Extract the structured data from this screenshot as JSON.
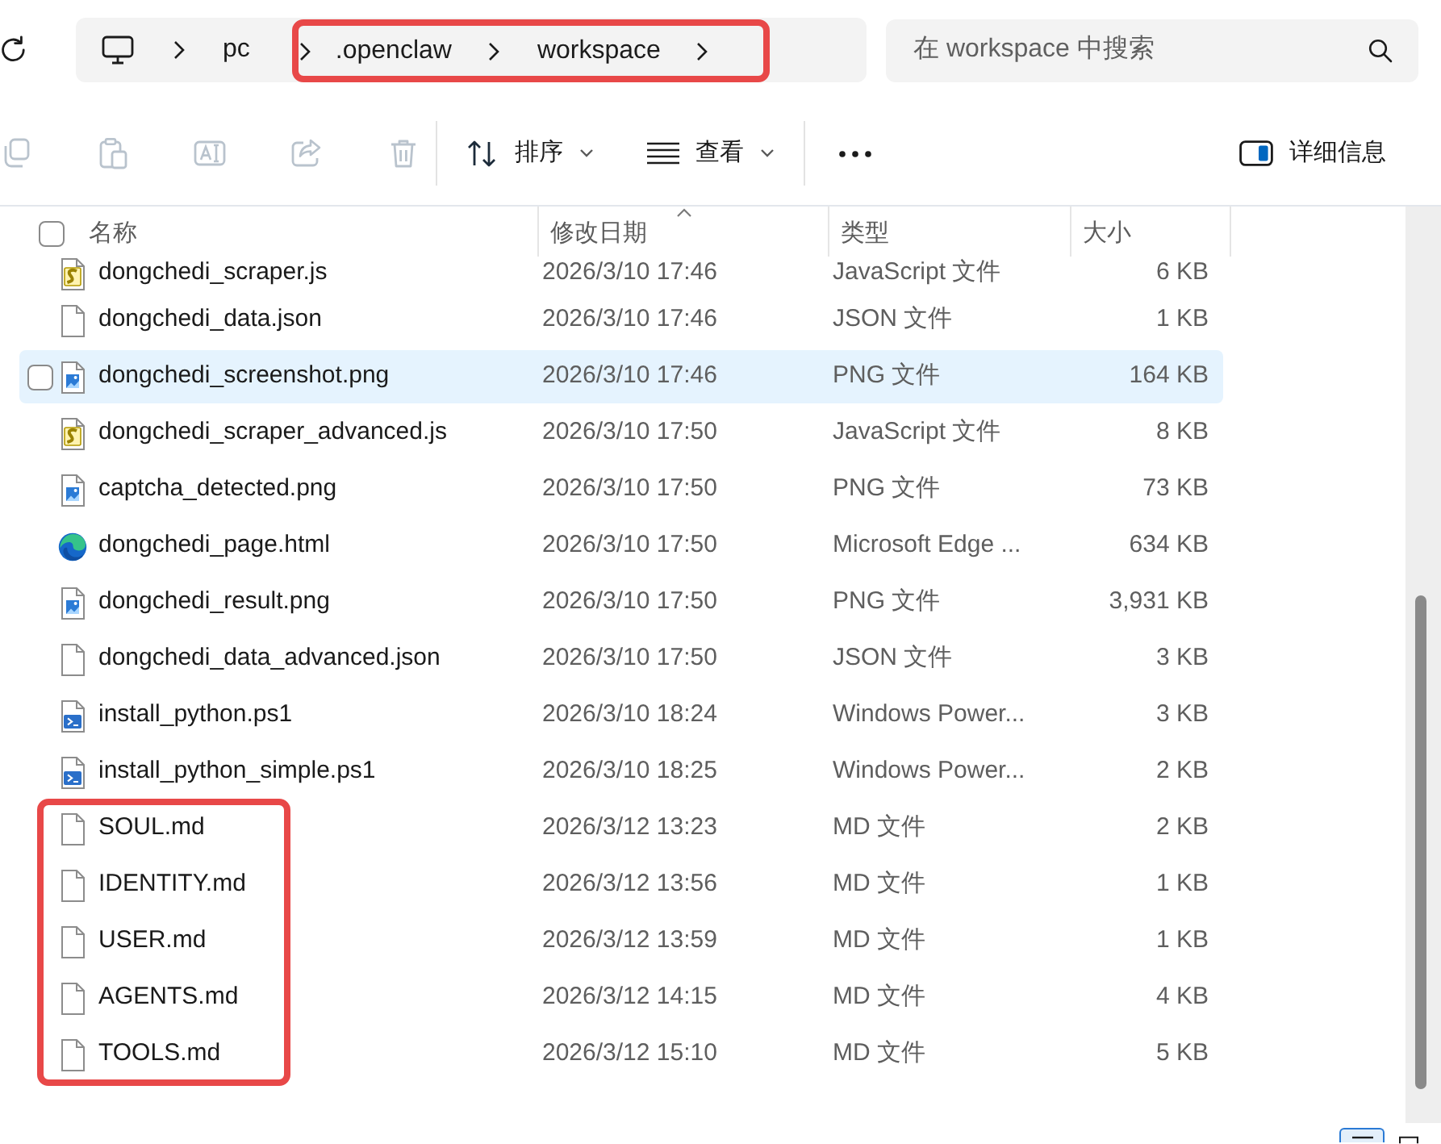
{
  "address_bar": {
    "crumbs": [
      {
        "label": "pc",
        "outlined": false
      },
      {
        "label": ".openclaw",
        "outlined": true
      },
      {
        "label": "workspace",
        "outlined": true
      }
    ]
  },
  "search": {
    "placeholder": "在 workspace 中搜索"
  },
  "toolbar": {
    "actions": [
      {
        "kind": "copy",
        "disabled": true
      },
      {
        "kind": "paste",
        "disabled": true
      },
      {
        "kind": "rename",
        "disabled": true
      },
      {
        "kind": "share",
        "disabled": true
      },
      {
        "kind": "delete",
        "disabled": true
      }
    ],
    "menus": [
      {
        "kind": "sort",
        "label": "排序"
      },
      {
        "kind": "view",
        "label": "查看"
      }
    ],
    "details": {
      "label": "详细信息"
    }
  },
  "file_list": {
    "select_all": {
      "checked": false
    },
    "columns": [
      {
        "label": "名称",
        "sorted": false
      },
      {
        "label": "修改日期",
        "sorted": true
      },
      {
        "label": "类型",
        "sorted": false
      },
      {
        "label": "大小",
        "sorted": false
      }
    ],
    "rows": [
      {
        "name": "dongchedi_scraper.js",
        "modified": "2026/3/10 17:46",
        "type": "JavaScript 文件",
        "size": "6 KB",
        "kind": "script",
        "highlighted": false,
        "selected": false
      },
      {
        "name": "dongchedi_data.json",
        "modified": "2026/3/10 17:46",
        "type": "JSON 文件",
        "size": "1 KB",
        "kind": "document",
        "highlighted": false,
        "selected": false
      },
      {
        "name": "dongchedi_screenshot.png",
        "modified": "2026/3/10 17:46",
        "type": "PNG 文件",
        "size": "164 KB",
        "kind": "image",
        "highlighted": true,
        "selected": false
      },
      {
        "name": "dongchedi_scraper_advanced.js",
        "modified": "2026/3/10 17:50",
        "type": "JavaScript 文件",
        "size": "8 KB",
        "kind": "script",
        "highlighted": false,
        "selected": false
      },
      {
        "name": "captcha_detected.png",
        "modified": "2026/3/10 17:50",
        "type": "PNG 文件",
        "size": "73 KB",
        "kind": "image",
        "highlighted": false,
        "selected": false
      },
      {
        "name": "dongchedi_page.html",
        "modified": "2026/3/10 17:50",
        "type": "Microsoft Edge ...",
        "size": "634 KB",
        "kind": "web",
        "highlighted": false,
        "selected": false
      },
      {
        "name": "dongchedi_result.png",
        "modified": "2026/3/10 17:50",
        "type": "PNG 文件",
        "size": "3,931 KB",
        "kind": "image",
        "highlighted": false,
        "selected": false
      },
      {
        "name": "dongchedi_data_advanced.json",
        "modified": "2026/3/10 17:50",
        "type": "JSON 文件",
        "size": "3 KB",
        "kind": "document",
        "highlighted": false,
        "selected": false
      },
      {
        "name": "install_python.ps1",
        "modified": "2026/3/10 18:24",
        "type": "Windows Power...",
        "size": "3 KB",
        "kind": "powershell",
        "highlighted": false,
        "selected": false
      },
      {
        "name": "install_python_simple.ps1",
        "modified": "2026/3/10 18:25",
        "type": "Windows Power...",
        "size": "2 KB",
        "kind": "powershell",
        "highlighted": false,
        "selected": false
      }
    ],
    "framed_rows": [
      {
        "name": "SOUL.md",
        "modified": "2026/3/12 13:23",
        "type": "MD 文件",
        "size": "2 KB",
        "kind": "document",
        "highlighted": false,
        "selected": false
      },
      {
        "name": "IDENTITY.md",
        "modified": "2026/3/12 13:56",
        "type": "MD 文件",
        "size": "1 KB",
        "kind": "document",
        "highlighted": false,
        "selected": false
      },
      {
        "name": "USER.md",
        "modified": "2026/3/12 13:59",
        "type": "MD 文件",
        "size": "1 KB",
        "kind": "document",
        "highlighted": false,
        "selected": false
      },
      {
        "name": "AGENTS.md",
        "modified": "2026/3/12 14:15",
        "type": "MD 文件",
        "size": "4 KB",
        "kind": "document",
        "highlighted": false,
        "selected": false
      },
      {
        "name": "TOOLS.md",
        "modified": "2026/3/12 15:10",
        "type": "MD 文件",
        "size": "5 KB",
        "kind": "document",
        "highlighted": false,
        "selected": false
      }
    ]
  },
  "view_buttons": [
    {
      "kind": "details",
      "selected": true
    },
    {
      "kind": "tiles",
      "selected": false
    }
  ]
}
